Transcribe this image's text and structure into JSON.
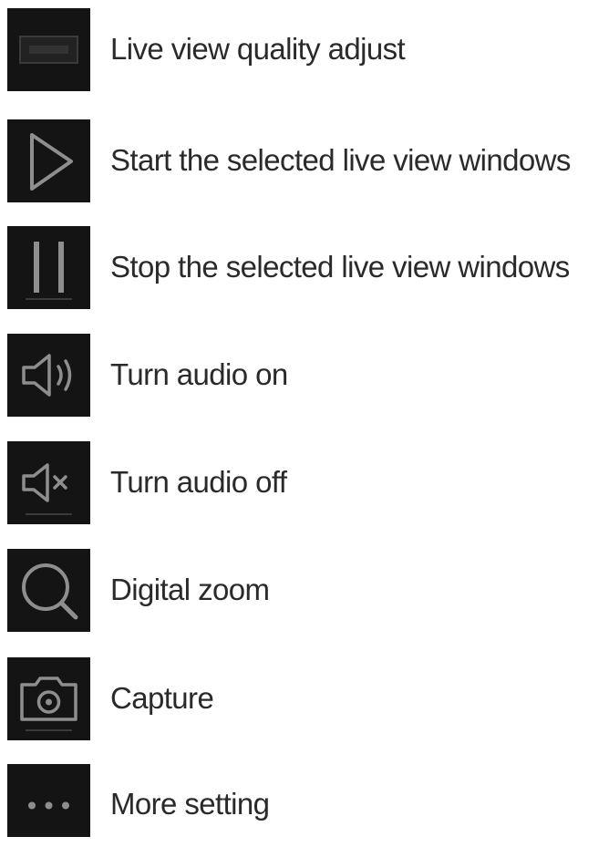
{
  "legend": {
    "items": [
      {
        "icon": "quality-icon",
        "label": "Live view quality adjust"
      },
      {
        "icon": "play-icon",
        "label": "Start the selected live view windows"
      },
      {
        "icon": "pause-icon",
        "label": "Stop the selected live view windows"
      },
      {
        "icon": "speaker-on-icon",
        "label": "Turn audio on"
      },
      {
        "icon": "speaker-mute-icon",
        "label": "Turn audio off"
      },
      {
        "icon": "magnifier-icon",
        "label": "Digital zoom"
      },
      {
        "icon": "camera-icon",
        "label": "Capture"
      },
      {
        "icon": "ellipsis-icon",
        "label": "More setting"
      }
    ]
  },
  "colors": {
    "tile_background": "#141414",
    "icon_stroke": "#8e8e8e",
    "text": "#2a2a2a",
    "page_background": "#ffffff"
  }
}
